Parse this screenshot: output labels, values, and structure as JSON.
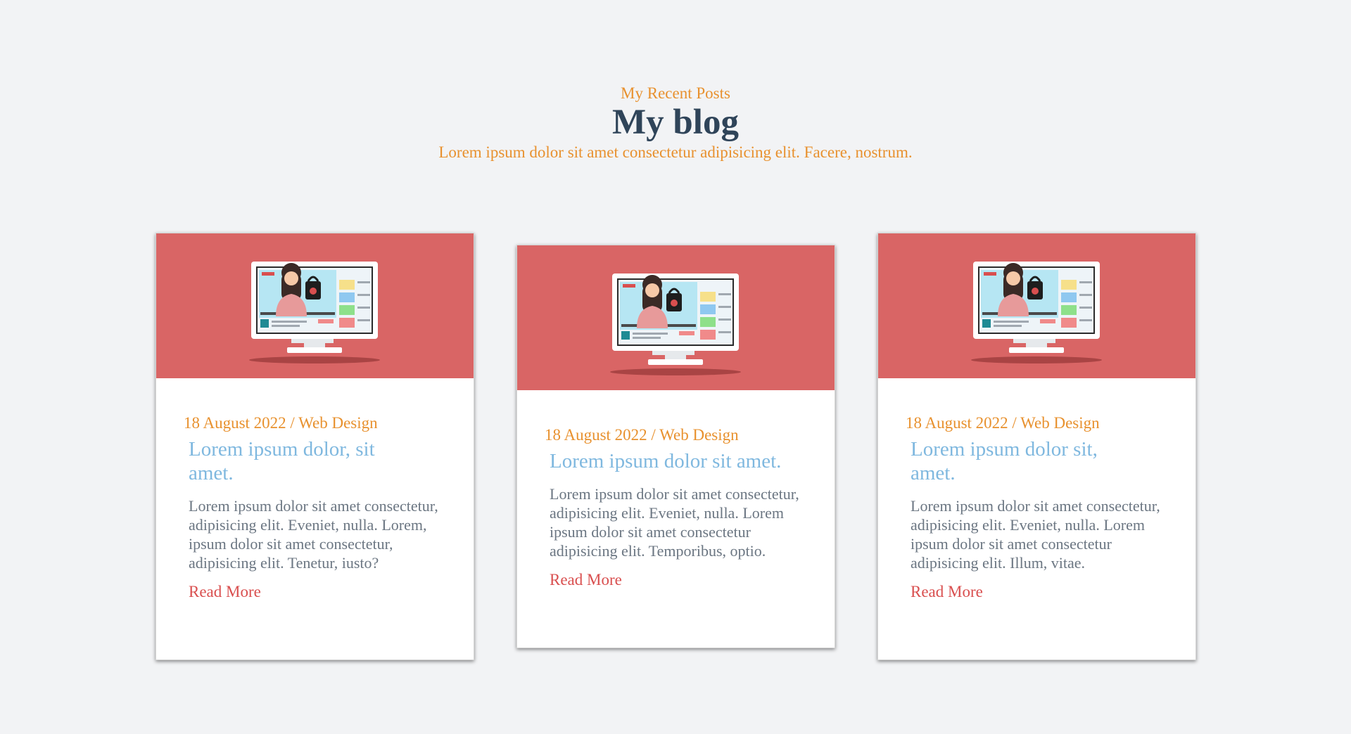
{
  "header": {
    "eyebrow": "My Recent Posts",
    "title": "My blog",
    "subtitle": "Lorem ipsum dolor sit amet consectetur adipisicing elit. Facere, nostrum."
  },
  "colors": {
    "accent_orange": "#e8912e",
    "heading_dark": "#2f4459",
    "card_image_bg": "#d96565",
    "post_title_blue": "#7fb8df",
    "read_more_red": "#d94f4f"
  },
  "posts": [
    {
      "date": "18 August 2022",
      "category": "Web Design",
      "meta": "18 August 2022 / Web Design",
      "title": "Lorem ipsum dolor, sit amet.",
      "excerpt": "Lorem ipsum dolor sit amet consectetur, adipisicing elit. Eveniet, nulla. Lorem, ipsum dolor sit amet consectetur, adipisicing elit. Tenetur, iusto?",
      "read_more": "Read More",
      "image_icon": "monitor-with-woman-illustration"
    },
    {
      "date": "18 August 2022",
      "category": "Web Design",
      "meta": "18 August 2022 / Web Design",
      "title": "Lorem ipsum dolor sit amet.",
      "excerpt": "Lorem ipsum dolor sit amet consectetur, adipisicing elit. Eveniet, nulla. Lorem ipsum dolor sit amet consectetur adipisicing elit. Temporibus, optio.",
      "read_more": "Read More",
      "image_icon": "monitor-with-woman-illustration"
    },
    {
      "date": "18 August 2022",
      "category": "Web Design",
      "meta": "18 August 2022 / Web Design",
      "title": "Lorem ipsum dolor sit, amet.",
      "excerpt": "Lorem ipsum dolor sit amet consectetur, adipisicing elit. Eveniet, nulla. Lorem ipsum dolor sit amet consectetur adipisicing elit. Illum, vitae.",
      "read_more": "Read More",
      "image_icon": "monitor-with-woman-illustration"
    }
  ]
}
